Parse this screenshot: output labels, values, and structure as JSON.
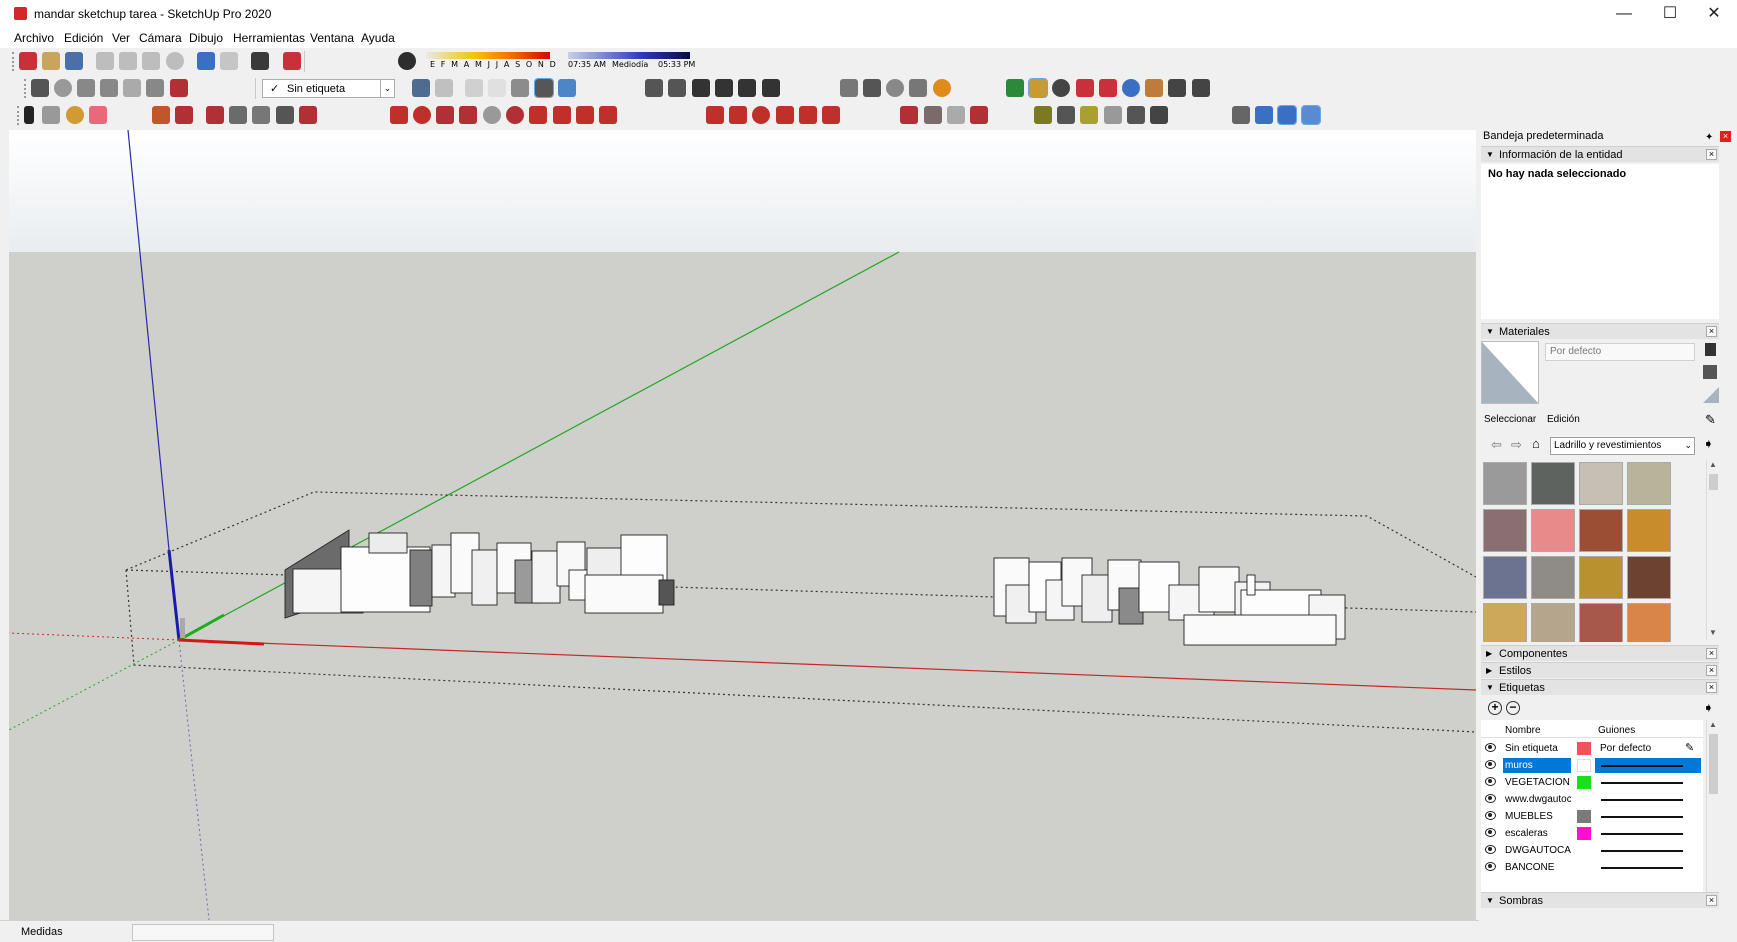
{
  "window": {
    "title": "mandar sketchup tarea - SketchUp Pro 2020",
    "minimize": "—",
    "maximize": "☐",
    "close": "✕"
  },
  "menu": [
    "Archivo",
    "Edición",
    "Ver",
    "Cámara",
    "Dibujo",
    "Herramientas",
    "Ventana",
    "Ayuda"
  ],
  "shadow_settings": {
    "months": "E F M A M J J A S O N D",
    "time_start": "07:35 AM",
    "time_mid": "Mediodía",
    "time_end": "05:33 PM"
  },
  "tag_selector": {
    "check": "✓",
    "value": "Sin etiqueta"
  },
  "status_bar": {
    "measure_label": "Medidas",
    "measure_value": ""
  },
  "tray": {
    "title": "Bandeja predeterminada",
    "entity_info": {
      "header": "Información de la entidad",
      "message": "No hay nada seleccionado"
    },
    "materials": {
      "header": "Materiales",
      "material_name": "Por defecto",
      "tabs": [
        "Seleccionar",
        "Edición"
      ],
      "library": "Ladrillo y revestimientos",
      "swatch_colors": [
        "#9a9a9a",
        "#5f6360",
        "#c7bfb3",
        "#b9b39a",
        "#8a6f72",
        "#e8898a",
        "#9a4e33",
        "#c88c2b",
        "#6b7390",
        "#8f8c88",
        "#b9912e",
        "#6b4330",
        "#cda75a",
        "#b5a58c",
        "#a7584a",
        "#d98449"
      ]
    },
    "components_header": "Componentes",
    "styles_header": "Estilos",
    "tags": {
      "header": "Etiquetas",
      "columns": [
        "Nombre",
        "Guiones"
      ],
      "rows": [
        {
          "name": "Sin etiqueta",
          "color": "#f0545a",
          "dash": "Por defecto",
          "selected": false
        },
        {
          "name": "muros",
          "color": "#ffffff",
          "dash": "",
          "selected": true
        },
        {
          "name": "VEGETACION",
          "color": "#19e01a",
          "dash": "",
          "selected": false
        },
        {
          "name": "www.dwgautoc",
          "color": "#ffffff",
          "dash": "",
          "selected": false
        },
        {
          "name": "MUEBLES",
          "color": "#7a7a7a",
          "dash": "",
          "selected": false
        },
        {
          "name": "escaleras",
          "color": "#ff10d0",
          "dash": "",
          "selected": false
        },
        {
          "name": "DWGAUTOCAD",
          "color": "#ffffff",
          "dash": "",
          "selected": false
        },
        {
          "name": "BANCONE",
          "color": "#ffffff",
          "dash": "",
          "selected": false
        }
      ]
    },
    "shadows_header": "Sombras"
  }
}
